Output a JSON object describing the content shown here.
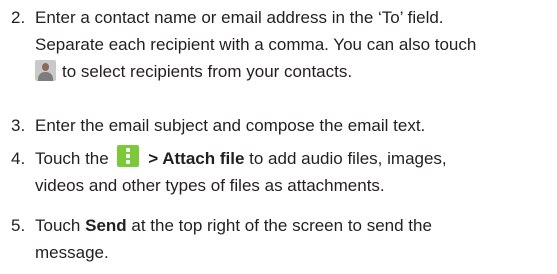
{
  "steps": [
    {
      "number": "2.",
      "line1": "Enter a contact name or email address in the ‘To’ field.",
      "line2": "Separate each recipient with a comma. You can also touch",
      "line3": "to select recipients from your contacts.",
      "icon": "contact-icon"
    },
    {
      "number": "3.",
      "line1": "Enter the email subject and compose the email text."
    },
    {
      "number": "4.",
      "pre": "Touch the",
      "icon": "menu-icon",
      "bold": "> Attach file",
      "post": "to add audio files, images,",
      "line2": "videos and other types of files as attachments."
    },
    {
      "number": "5.",
      "pre": "Touch",
      "bold": "Send",
      "post": "at the top right of the screen to send the",
      "line2": "message."
    }
  ],
  "colors": {
    "text": "#231f20",
    "menu_icon_bg": "#7cc93a",
    "contact_icon_bg": "#c9c9c9"
  }
}
